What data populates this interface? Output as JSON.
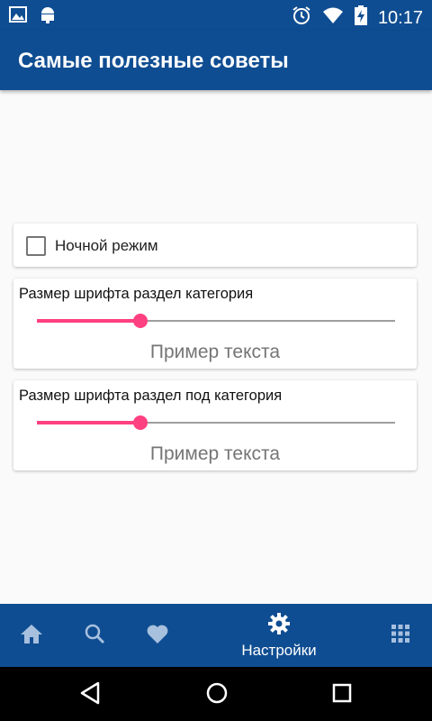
{
  "status_bar": {
    "time": "10:17",
    "left_icons": [
      "image-icon",
      "android-icon"
    ],
    "right_icons": [
      "alarm-icon",
      "wifi-icon",
      "battery-charging-icon"
    ]
  },
  "app_bar": {
    "title": "Самые полезные советы"
  },
  "settings": {
    "night_mode": {
      "label": "Ночной режим",
      "checked": false
    },
    "category_font": {
      "label": "Размер шрифта раздел категория",
      "slider_value": 0.29,
      "sample": "Пример текста"
    },
    "subcategory_font": {
      "label": "Размер шрифта раздел под категория",
      "slider_value": 0.29,
      "sample": "Пример текста"
    }
  },
  "bottom_nav": {
    "items": [
      {
        "icon": "home-icon"
      },
      {
        "icon": "search-icon"
      },
      {
        "icon": "heart-icon"
      },
      {
        "icon": "gear-icon",
        "label": "Настройки",
        "active": true
      },
      {
        "icon": "apps-grid-icon"
      }
    ]
  },
  "system_nav": {
    "buttons": [
      "back-icon",
      "home-circle-icon",
      "recents-icon"
    ]
  },
  "colors": {
    "primary": "#0f4d92",
    "accent": "#ff4081",
    "nav_inactive": "#a7c0de"
  }
}
